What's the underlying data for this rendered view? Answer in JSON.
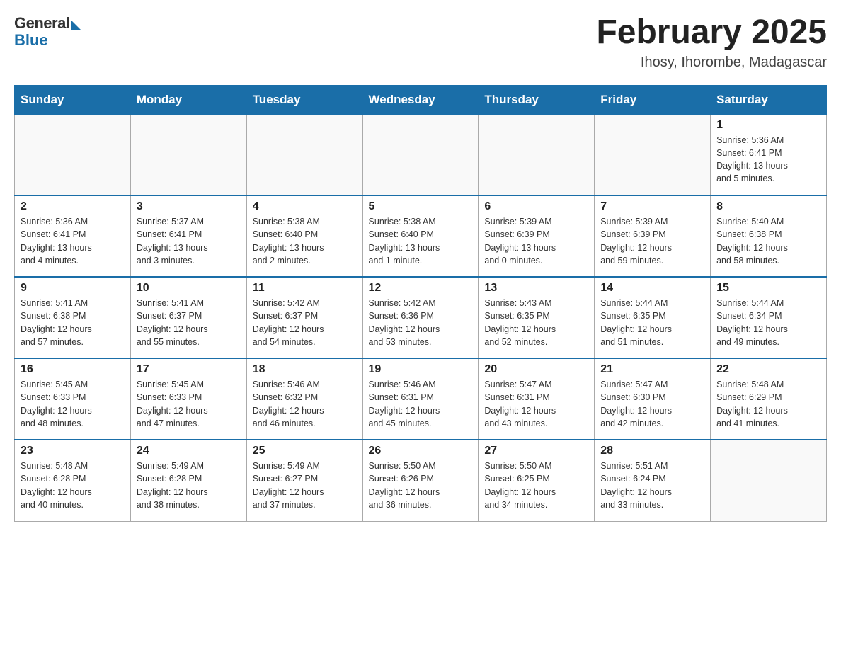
{
  "logo": {
    "general": "General",
    "blue": "Blue"
  },
  "title": "February 2025",
  "location": "Ihosy, Ihorombe, Madagascar",
  "days_of_week": [
    "Sunday",
    "Monday",
    "Tuesday",
    "Wednesday",
    "Thursday",
    "Friday",
    "Saturday"
  ],
  "weeks": [
    [
      {
        "day": "",
        "info": ""
      },
      {
        "day": "",
        "info": ""
      },
      {
        "day": "",
        "info": ""
      },
      {
        "day": "",
        "info": ""
      },
      {
        "day": "",
        "info": ""
      },
      {
        "day": "",
        "info": ""
      },
      {
        "day": "1",
        "info": "Sunrise: 5:36 AM\nSunset: 6:41 PM\nDaylight: 13 hours\nand 5 minutes."
      }
    ],
    [
      {
        "day": "2",
        "info": "Sunrise: 5:36 AM\nSunset: 6:41 PM\nDaylight: 13 hours\nand 4 minutes."
      },
      {
        "day": "3",
        "info": "Sunrise: 5:37 AM\nSunset: 6:41 PM\nDaylight: 13 hours\nand 3 minutes."
      },
      {
        "day": "4",
        "info": "Sunrise: 5:38 AM\nSunset: 6:40 PM\nDaylight: 13 hours\nand 2 minutes."
      },
      {
        "day": "5",
        "info": "Sunrise: 5:38 AM\nSunset: 6:40 PM\nDaylight: 13 hours\nand 1 minute."
      },
      {
        "day": "6",
        "info": "Sunrise: 5:39 AM\nSunset: 6:39 PM\nDaylight: 13 hours\nand 0 minutes."
      },
      {
        "day": "7",
        "info": "Sunrise: 5:39 AM\nSunset: 6:39 PM\nDaylight: 12 hours\nand 59 minutes."
      },
      {
        "day": "8",
        "info": "Sunrise: 5:40 AM\nSunset: 6:38 PM\nDaylight: 12 hours\nand 58 minutes."
      }
    ],
    [
      {
        "day": "9",
        "info": "Sunrise: 5:41 AM\nSunset: 6:38 PM\nDaylight: 12 hours\nand 57 minutes."
      },
      {
        "day": "10",
        "info": "Sunrise: 5:41 AM\nSunset: 6:37 PM\nDaylight: 12 hours\nand 55 minutes."
      },
      {
        "day": "11",
        "info": "Sunrise: 5:42 AM\nSunset: 6:37 PM\nDaylight: 12 hours\nand 54 minutes."
      },
      {
        "day": "12",
        "info": "Sunrise: 5:42 AM\nSunset: 6:36 PM\nDaylight: 12 hours\nand 53 minutes."
      },
      {
        "day": "13",
        "info": "Sunrise: 5:43 AM\nSunset: 6:35 PM\nDaylight: 12 hours\nand 52 minutes."
      },
      {
        "day": "14",
        "info": "Sunrise: 5:44 AM\nSunset: 6:35 PM\nDaylight: 12 hours\nand 51 minutes."
      },
      {
        "day": "15",
        "info": "Sunrise: 5:44 AM\nSunset: 6:34 PM\nDaylight: 12 hours\nand 49 minutes."
      }
    ],
    [
      {
        "day": "16",
        "info": "Sunrise: 5:45 AM\nSunset: 6:33 PM\nDaylight: 12 hours\nand 48 minutes."
      },
      {
        "day": "17",
        "info": "Sunrise: 5:45 AM\nSunset: 6:33 PM\nDaylight: 12 hours\nand 47 minutes."
      },
      {
        "day": "18",
        "info": "Sunrise: 5:46 AM\nSunset: 6:32 PM\nDaylight: 12 hours\nand 46 minutes."
      },
      {
        "day": "19",
        "info": "Sunrise: 5:46 AM\nSunset: 6:31 PM\nDaylight: 12 hours\nand 45 minutes."
      },
      {
        "day": "20",
        "info": "Sunrise: 5:47 AM\nSunset: 6:31 PM\nDaylight: 12 hours\nand 43 minutes."
      },
      {
        "day": "21",
        "info": "Sunrise: 5:47 AM\nSunset: 6:30 PM\nDaylight: 12 hours\nand 42 minutes."
      },
      {
        "day": "22",
        "info": "Sunrise: 5:48 AM\nSunset: 6:29 PM\nDaylight: 12 hours\nand 41 minutes."
      }
    ],
    [
      {
        "day": "23",
        "info": "Sunrise: 5:48 AM\nSunset: 6:28 PM\nDaylight: 12 hours\nand 40 minutes."
      },
      {
        "day": "24",
        "info": "Sunrise: 5:49 AM\nSunset: 6:28 PM\nDaylight: 12 hours\nand 38 minutes."
      },
      {
        "day": "25",
        "info": "Sunrise: 5:49 AM\nSunset: 6:27 PM\nDaylight: 12 hours\nand 37 minutes."
      },
      {
        "day": "26",
        "info": "Sunrise: 5:50 AM\nSunset: 6:26 PM\nDaylight: 12 hours\nand 36 minutes."
      },
      {
        "day": "27",
        "info": "Sunrise: 5:50 AM\nSunset: 6:25 PM\nDaylight: 12 hours\nand 34 minutes."
      },
      {
        "day": "28",
        "info": "Sunrise: 5:51 AM\nSunset: 6:24 PM\nDaylight: 12 hours\nand 33 minutes."
      },
      {
        "day": "",
        "info": ""
      }
    ]
  ]
}
